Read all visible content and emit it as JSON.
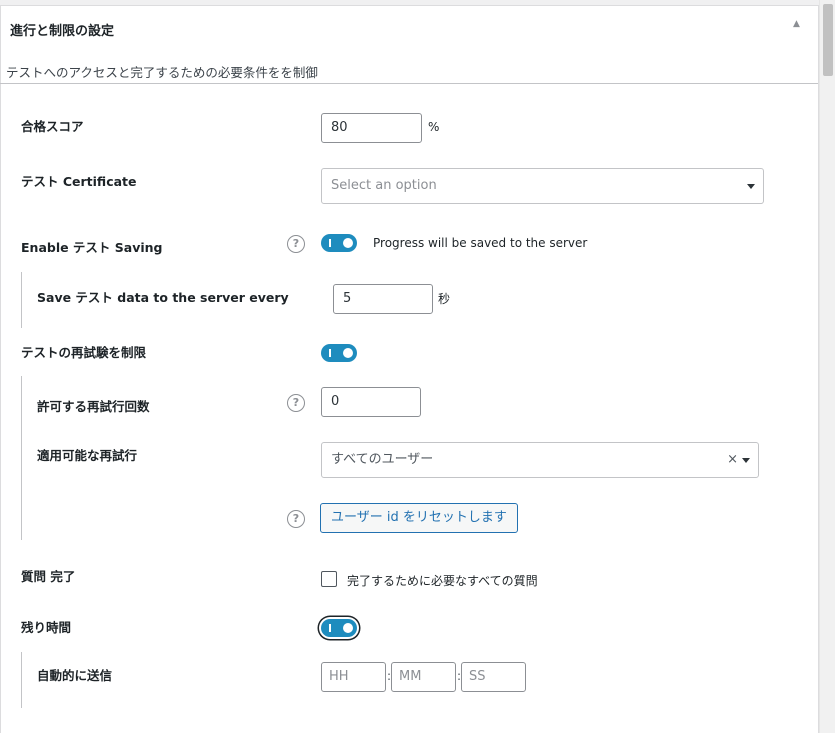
{
  "section": {
    "title": "進行と制限の設定",
    "description": "テストへのアクセスと完了するための必要条件をを制御"
  },
  "pass_score": {
    "label": "合格スコア",
    "value": "80",
    "unit": "%"
  },
  "certificate": {
    "label": "テスト Certificate",
    "placeholder": "Select an option"
  },
  "saving": {
    "label": "Enable テスト Saving",
    "enabled": true,
    "description": "Progress will be saved to the server"
  },
  "save_interval": {
    "label": "Save テスト data to the server every",
    "value": "5",
    "unit": "秒"
  },
  "limit_retakes": {
    "label": "テストの再試験を制限",
    "enabled": true
  },
  "retakes_allowed": {
    "label": "許可する再試行回数",
    "value": "0"
  },
  "retakes_applicable": {
    "label": "適用可能な再試行",
    "value": "すべてのユーザー",
    "clear_symbol": "×"
  },
  "reset_button": {
    "label": "ユーザー id をリセットします"
  },
  "question_completion": {
    "label": "質問 完了",
    "checkbox_label": "完了するために必要なすべての質問",
    "checked": false
  },
  "time_remaining": {
    "label": "残り時間",
    "enabled": true
  },
  "auto_submit": {
    "label": "自動的に送信",
    "hours_placeholder": "HH",
    "minutes_placeholder": "MM",
    "seconds_placeholder": "SS",
    "separator": ":"
  },
  "help_symbol": "?",
  "collapse_symbol": "▲",
  "colors": {
    "accent": "#1e8cbe",
    "link": "#2271b1",
    "border": "#8c8f94"
  }
}
